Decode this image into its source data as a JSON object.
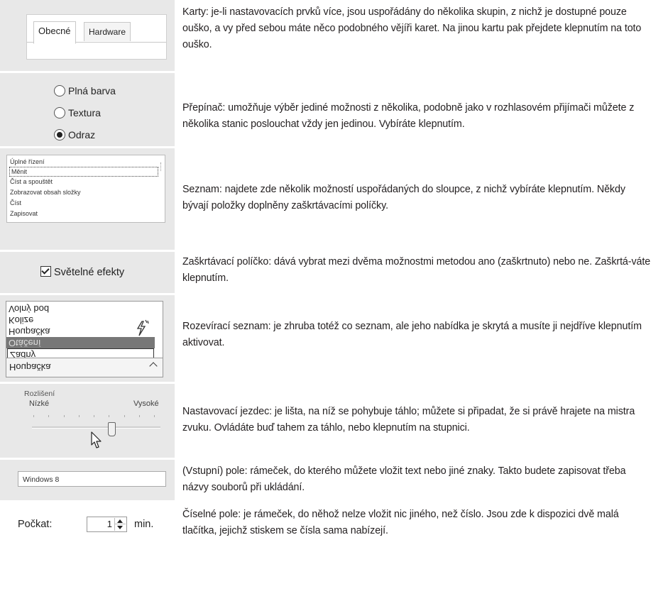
{
  "rows": [
    {
      "description": "Karty: je-li nastavovacích prvků více, jsou uspořádány do několika skupin, z nichž je dostupné pouze ouško, a vy před sebou máte něco podobného vějíři karet. Na jinou kartu pak přejdete klepnutím na toto ouško.",
      "tabs": [
        "Obecné",
        "Hardware"
      ]
    },
    {
      "description": "Přepínač: umožňuje výběr jediné možnosti z několika, podobně jako v rozhlasovém přijímači můžete z několika stanic poslouchat vždy jen jedinou. Vybíráte klepnutím.",
      "options": [
        "Plná barva",
        "Textura",
        "Odraz"
      ],
      "selected": "Odraz"
    },
    {
      "description": "Seznam: najdete zde několik možností uspořádaných do sloupce, z nichž vybíráte klepnutím. Někdy bývají položky doplněny zaškrtávacími políčky.",
      "items": [
        "Úplné řízení",
        "Měnit",
        "Číst a spouštět",
        "Zobrazovat obsah složky",
        "Číst",
        "Zapisovat"
      ]
    },
    {
      "description": "Zaškrtávací políčko: dává vybrat mezi dvěma možnostmi metodou ano (zaškrtnuto) nebo ne. Zaškrtá-váte klepnutím.",
      "checkbox_label": "Světelné efekty",
      "checked": true
    },
    {
      "description": "Rozevírací seznam: je zhruba totéž co seznam, ale jeho nabídka je skrytá a musíte ji nejdříve klepnutím aktivovat.",
      "items": [
        "Volný bod",
        "Kolize",
        "Houpačka",
        "Otáčení",
        "Žádný"
      ],
      "current": "Houpačka"
    },
    {
      "description": "Nastavovací jezdec: je lišta, na níž se pohybuje táhlo; můžete si připadat, že si právě hrajete na mistra zvuku. Ovládáte buď tahem za táhlo, nebo klepnutím na stupnici.",
      "slider_title": "Rozlišení",
      "low_label": "Nízké",
      "high_label": "Vysoké",
      "level": 0.62
    },
    {
      "description": "(Vstupní) pole: rámeček, do kterého můžete vložit text nebo jiné znaky. Takto budete zapisovat třeba názvy souborů při ukládání.",
      "field_value": "Windows 8"
    },
    {
      "description": "Číselné pole: je rámeček, do něhož nelze vložit nic jiného, než číslo. Jsou zde k dispozici dvě malá tlačítka, jejichž stiskem se čísla sama nabízejí.",
      "label": "Počkat:",
      "value": "1",
      "unit": "min."
    }
  ]
}
